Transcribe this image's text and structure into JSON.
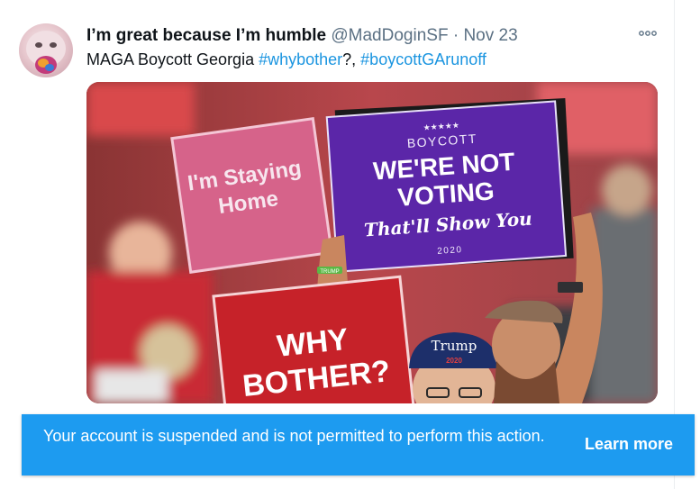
{
  "tweet": {
    "display_name": "I’m great because I’m humble",
    "handle": "@MadDoginSF",
    "separator": "·",
    "date": "Nov 23",
    "text_prefix": "MAGA Boycott Georgia ",
    "hashtag1": "#whybother",
    "text_mid": "?, ",
    "hashtag2": "#boycottGArunoff",
    "more_icon": "more-horizontal-icon"
  },
  "photo": {
    "sign_pink": [
      "I'm Staying",
      "Home"
    ],
    "sign_purple": {
      "stars": "★★★★★",
      "top": "BOYCOTT",
      "line1": "WE'RE NOT",
      "line2": "VOTING",
      "script": "That'll Show You",
      "year": "2020"
    },
    "sign_red": [
      "WHY",
      "BOTHER?"
    ],
    "cap_text": [
      "Trump",
      "2020"
    ],
    "wristband": "TRUMP"
  },
  "banner": {
    "message": "Your account is suspended and is not permitted to perform this action.",
    "link": "Learn more",
    "color": "#1d9bf0"
  }
}
